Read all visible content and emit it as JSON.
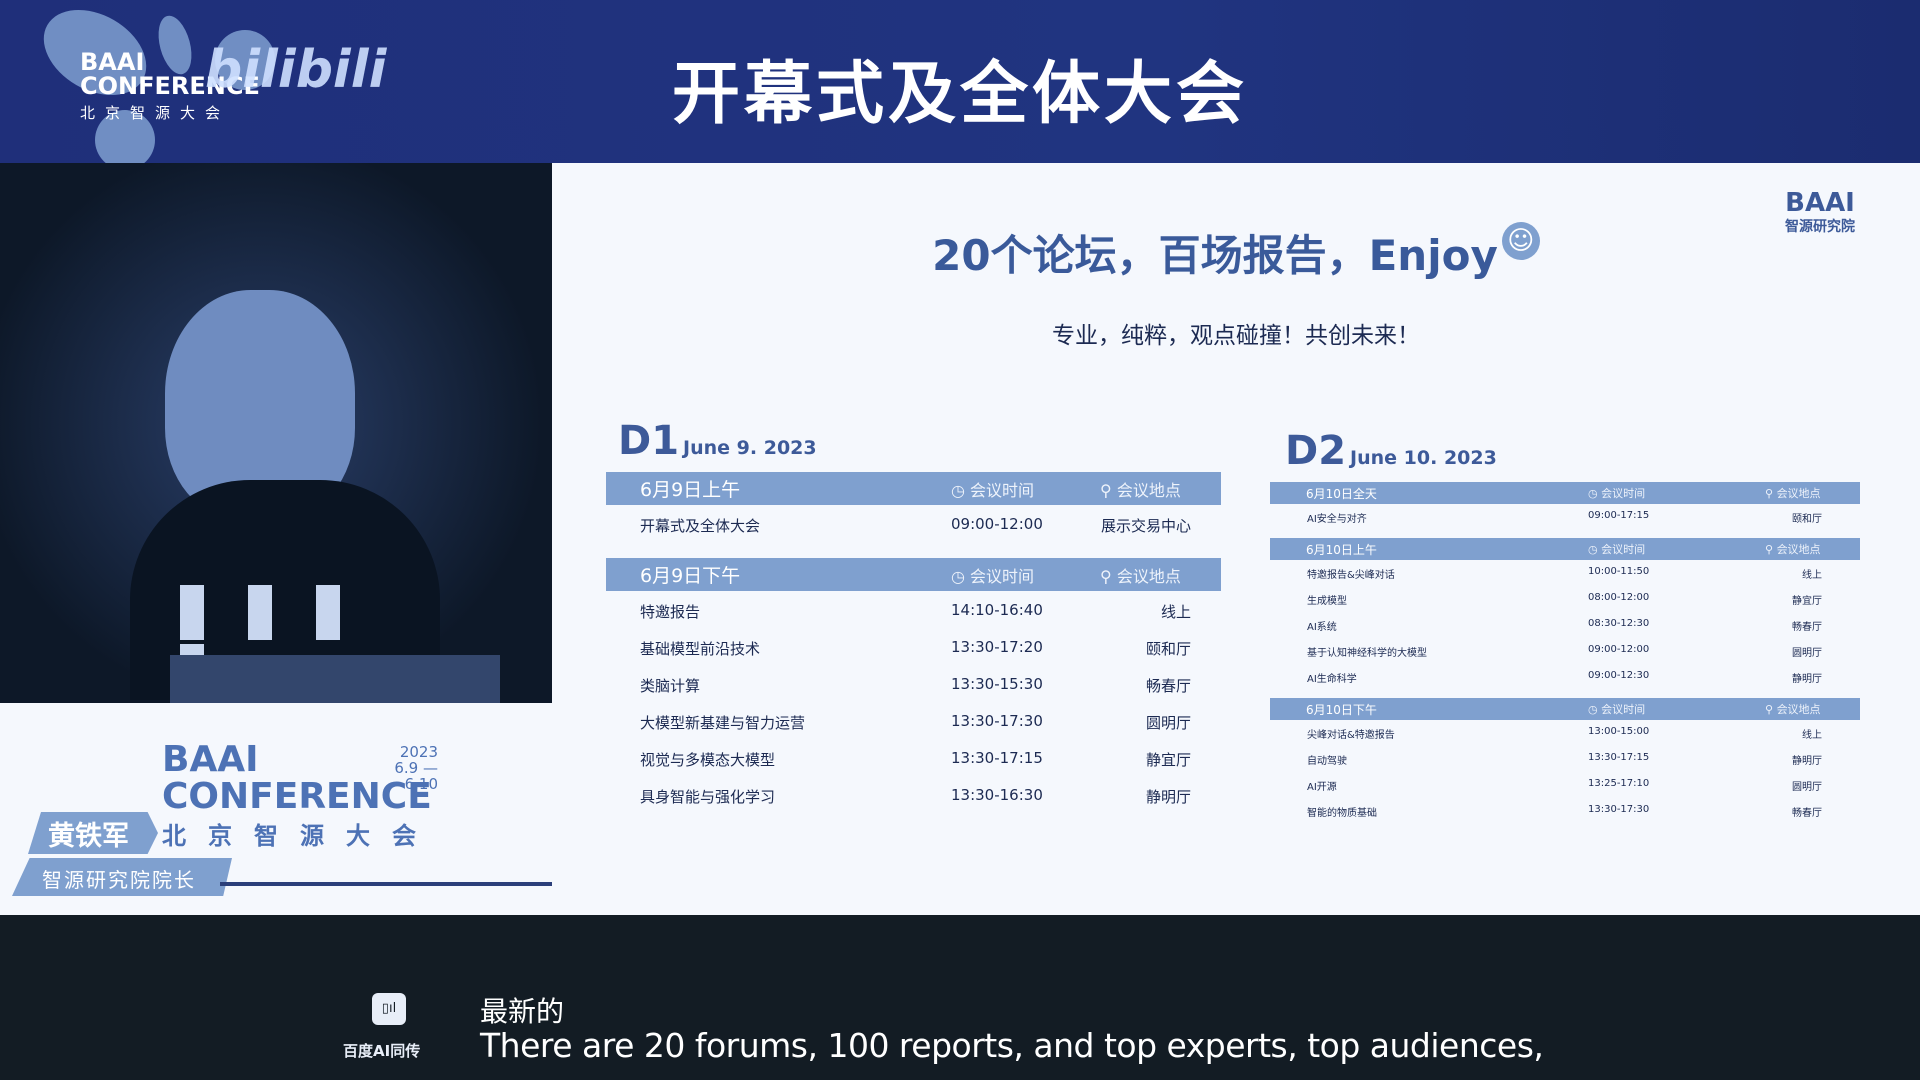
{
  "header": {
    "title": "开幕式及全体大会",
    "logo_en_1": "BAAI",
    "logo_en_2": "CONFERENCE",
    "logo_cn": "北京智源大会",
    "platform_logo": "bilibili"
  },
  "speaker": {
    "name": "黄铁军",
    "role": "智源研究院院长"
  },
  "conference_logo": {
    "en_1": "BAAI",
    "en_2": "CONFERENCE",
    "cn": "北京智源大会",
    "year": "2023",
    "dates": "6.9 — 6.10"
  },
  "slide": {
    "heading": "20个论坛，百场报告，Enjoy",
    "emoji": "😁",
    "subheading": "专业，纯粹，观点碰撞！共创未来！",
    "logo_en": "BAAI",
    "logo_cn": "智源研究院",
    "time_col": "会议时间",
    "place_col": "会议地点",
    "day1": {
      "label": "D1",
      "date": "June 9. 2023",
      "sections": [
        {
          "title": "6月9日上午",
          "rows": [
            {
              "name": "开幕式及全体大会",
              "time": "09:00-12:00",
              "place": "展示交易中心"
            }
          ]
        },
        {
          "title": "6月9日下午",
          "rows": [
            {
              "name": "特邀报告",
              "time": "14:10-16:40",
              "place": "线上"
            },
            {
              "name": "基础模型前沿技术",
              "time": "13:30-17:20",
              "place": "颐和厅"
            },
            {
              "name": "类脑计算",
              "time": "13:30-15:30",
              "place": "畅春厅"
            },
            {
              "name": "大模型新基建与智力运营",
              "time": "13:30-17:30",
              "place": "圆明厅"
            },
            {
              "name": "视觉与多模态大模型",
              "time": "13:30-17:15",
              "place": "静宜厅"
            },
            {
              "name": "具身智能与强化学习",
              "time": "13:30-16:30",
              "place": "静明厅"
            }
          ]
        }
      ]
    },
    "day2": {
      "label": "D2",
      "date": "June 10. 2023",
      "sections": [
        {
          "title": "6月10日全天",
          "rows": [
            {
              "name": "AI安全与对齐",
              "time": "09:00-17:15",
              "place": "颐和厅"
            }
          ]
        },
        {
          "title": "6月10日上午",
          "rows": [
            {
              "name": "特邀报告&尖峰对话",
              "time": "10:00-11:50",
              "place": "线上"
            },
            {
              "name": "生成模型",
              "time": "08:00-12:00",
              "place": "静宜厅"
            },
            {
              "name": "AI系统",
              "time": "08:30-12:30",
              "place": "畅春厅"
            },
            {
              "name": "基于认知神经科学的大模型",
              "time": "09:00-12:00",
              "place": "圆明厅"
            },
            {
              "name": "AI生命科学",
              "time": "09:00-12:30",
              "place": "静明厅"
            }
          ]
        },
        {
          "title": "6月10日下午",
          "rows": [
            {
              "name": "尖峰对话&特邀报告",
              "time": "13:00-15:00",
              "place": "线上"
            },
            {
              "name": "自动驾驶",
              "time": "13:30-17:15",
              "place": "静明厅"
            },
            {
              "name": "AI开源",
              "time": "13:25-17:10",
              "place": "圆明厅"
            },
            {
              "name": "智能的物质基础",
              "time": "13:30-17:30",
              "place": "畅春厅"
            }
          ]
        }
      ]
    }
  },
  "captions": {
    "provider": "百度AI同传",
    "chinese": "最新的",
    "english": "There are 20 forums, 100 reports, and top experts, top audiences,"
  }
}
